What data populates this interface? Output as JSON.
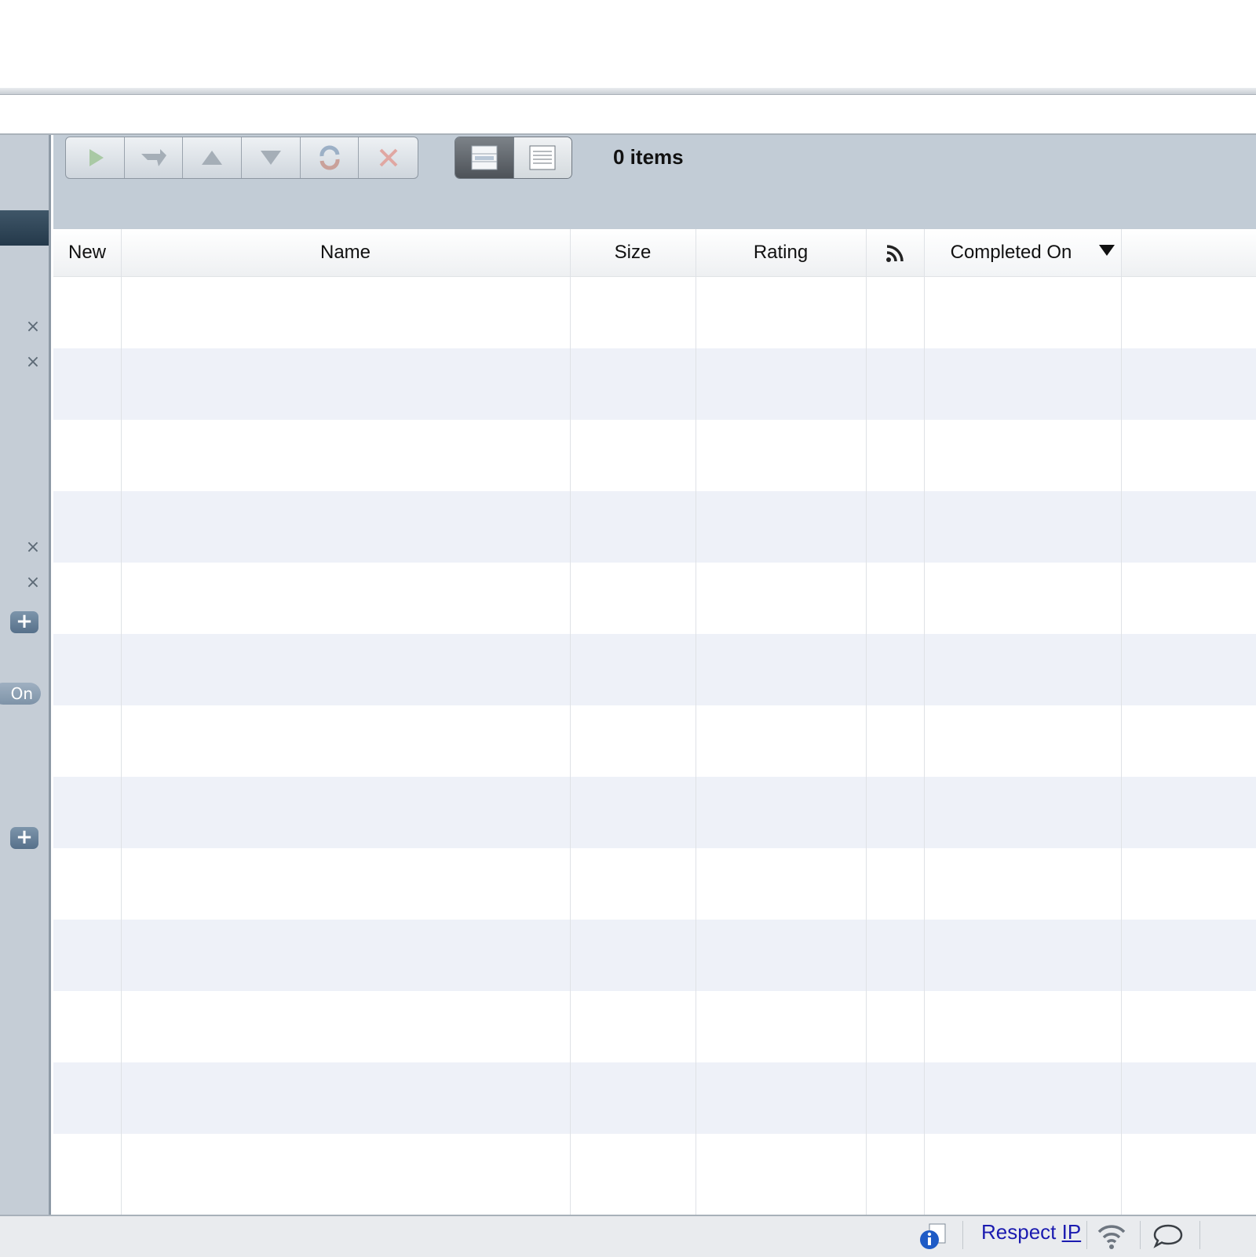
{
  "toolbar": {
    "items_count": "0 items",
    "buttons": [
      {
        "name": "play-icon"
      },
      {
        "name": "turn-icon"
      },
      {
        "name": "move-up-icon"
      },
      {
        "name": "move-down-icon"
      },
      {
        "name": "refresh-icon"
      },
      {
        "name": "delete-icon"
      }
    ],
    "views": [
      "list-view-icon",
      "detail-view-icon"
    ]
  },
  "table": {
    "columns": [
      "New",
      "Name",
      "Size",
      "Rating",
      "",
      "Completed On"
    ],
    "feed_icon": "rss-icon",
    "sorted_column": "Completed On",
    "sort_direction": "descending"
  },
  "sidebar": {
    "toggle_label": "On",
    "close_marks": [
      "×",
      "×",
      "×",
      "×"
    ],
    "add_marks": [
      "+",
      "+"
    ]
  },
  "status_bar": {
    "respect_label": "Respect ",
    "respect_underlined": "IP"
  },
  "colors": {
    "toolbar_bg": "#c2ccd6",
    "row_alt": "#eef1f8",
    "link": "#1b1bb0"
  }
}
